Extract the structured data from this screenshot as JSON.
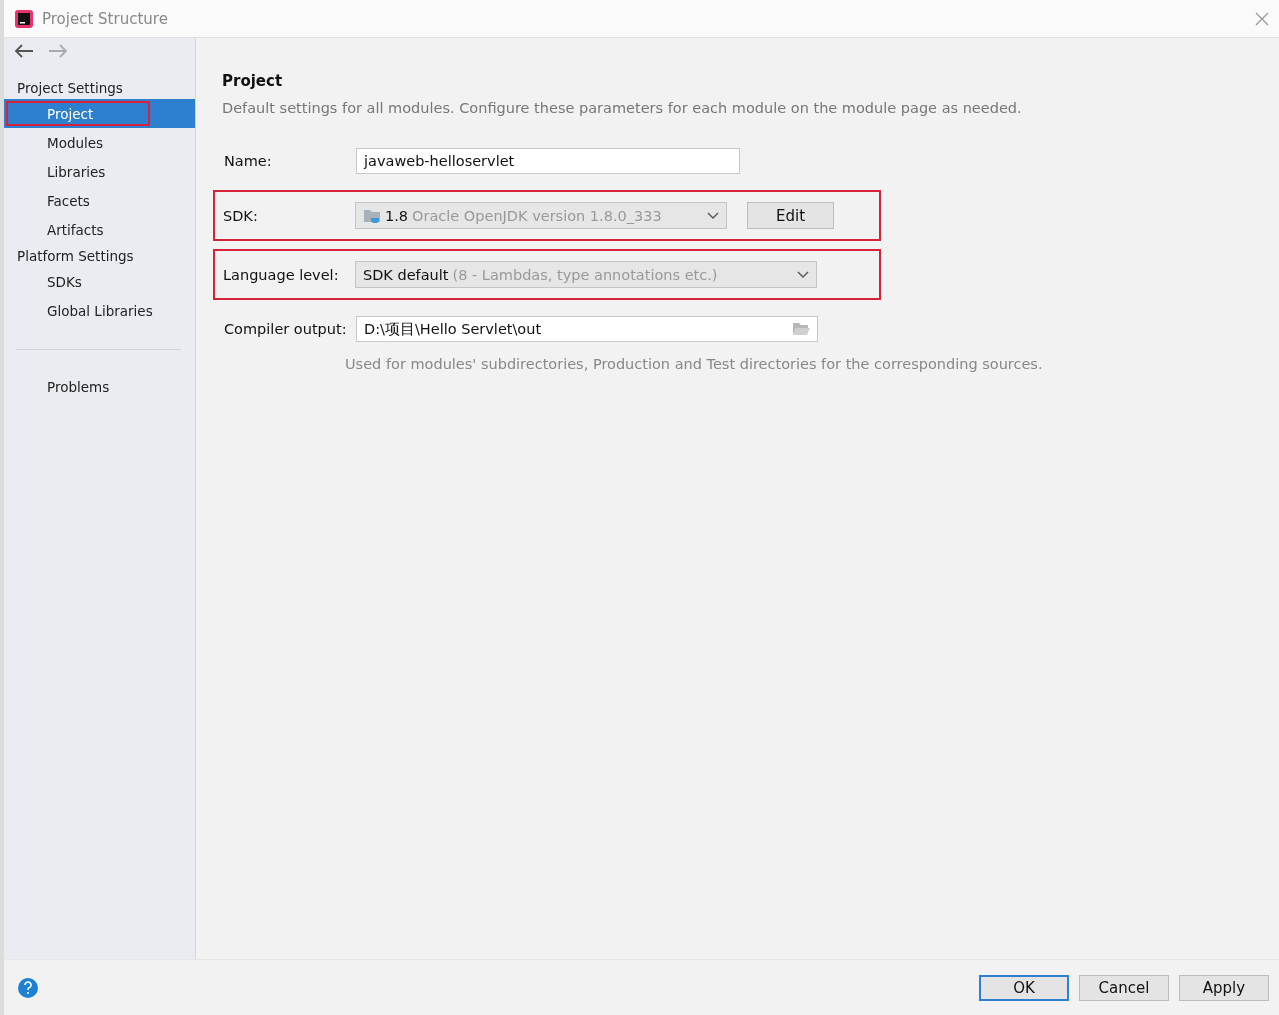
{
  "window": {
    "title": "Project Structure"
  },
  "sidebar": {
    "items": [
      {
        "kind": "header",
        "label": "Project Settings"
      },
      {
        "kind": "item",
        "label": "Project",
        "selected": true,
        "highlighted": true
      },
      {
        "kind": "item",
        "label": "Modules",
        "selected": false,
        "highlighted": false
      },
      {
        "kind": "item",
        "label": "Libraries",
        "selected": false,
        "highlighted": false
      },
      {
        "kind": "item",
        "label": "Facets",
        "selected": false,
        "highlighted": false
      },
      {
        "kind": "item",
        "label": "Artifacts",
        "selected": false,
        "highlighted": false
      },
      {
        "kind": "header",
        "label": "Platform Settings"
      },
      {
        "kind": "item",
        "label": "SDKs",
        "selected": false,
        "highlighted": false
      },
      {
        "kind": "item",
        "label": "Global Libraries",
        "selected": false,
        "highlighted": false
      },
      {
        "kind": "separator"
      },
      {
        "kind": "item",
        "label": "Problems",
        "selected": false,
        "highlighted": false
      }
    ]
  },
  "content": {
    "title": "Project",
    "description": "Default settings for all modules. Configure these parameters for each module on the module page as needed.",
    "rows": [
      {
        "kind": "text",
        "label": "Name:",
        "value": "javaweb-helloservlet",
        "highlighted": false
      },
      {
        "kind": "combo",
        "label": "SDK:",
        "value": "1.8",
        "detail": "Oracle OpenJDK version 1.8.0_333",
        "button": "Edit",
        "highlighted": true
      },
      {
        "kind": "combo",
        "label": "Language level:",
        "value": "SDK default",
        "detail": "(8 - Lambdas, type annotations etc.)",
        "highlighted": true
      },
      {
        "kind": "path",
        "label": "Compiler output:",
        "value": "D:\\项目\\Hello Servlet\\out",
        "hint": "Used for modules' subdirectories, Production and Test directories for the corresponding sources.",
        "highlighted": false
      }
    ]
  },
  "footer": {
    "buttons": [
      {
        "label": "OK",
        "default": true
      },
      {
        "label": "Cancel",
        "default": false
      },
      {
        "label": "Apply",
        "default": false
      }
    ]
  }
}
